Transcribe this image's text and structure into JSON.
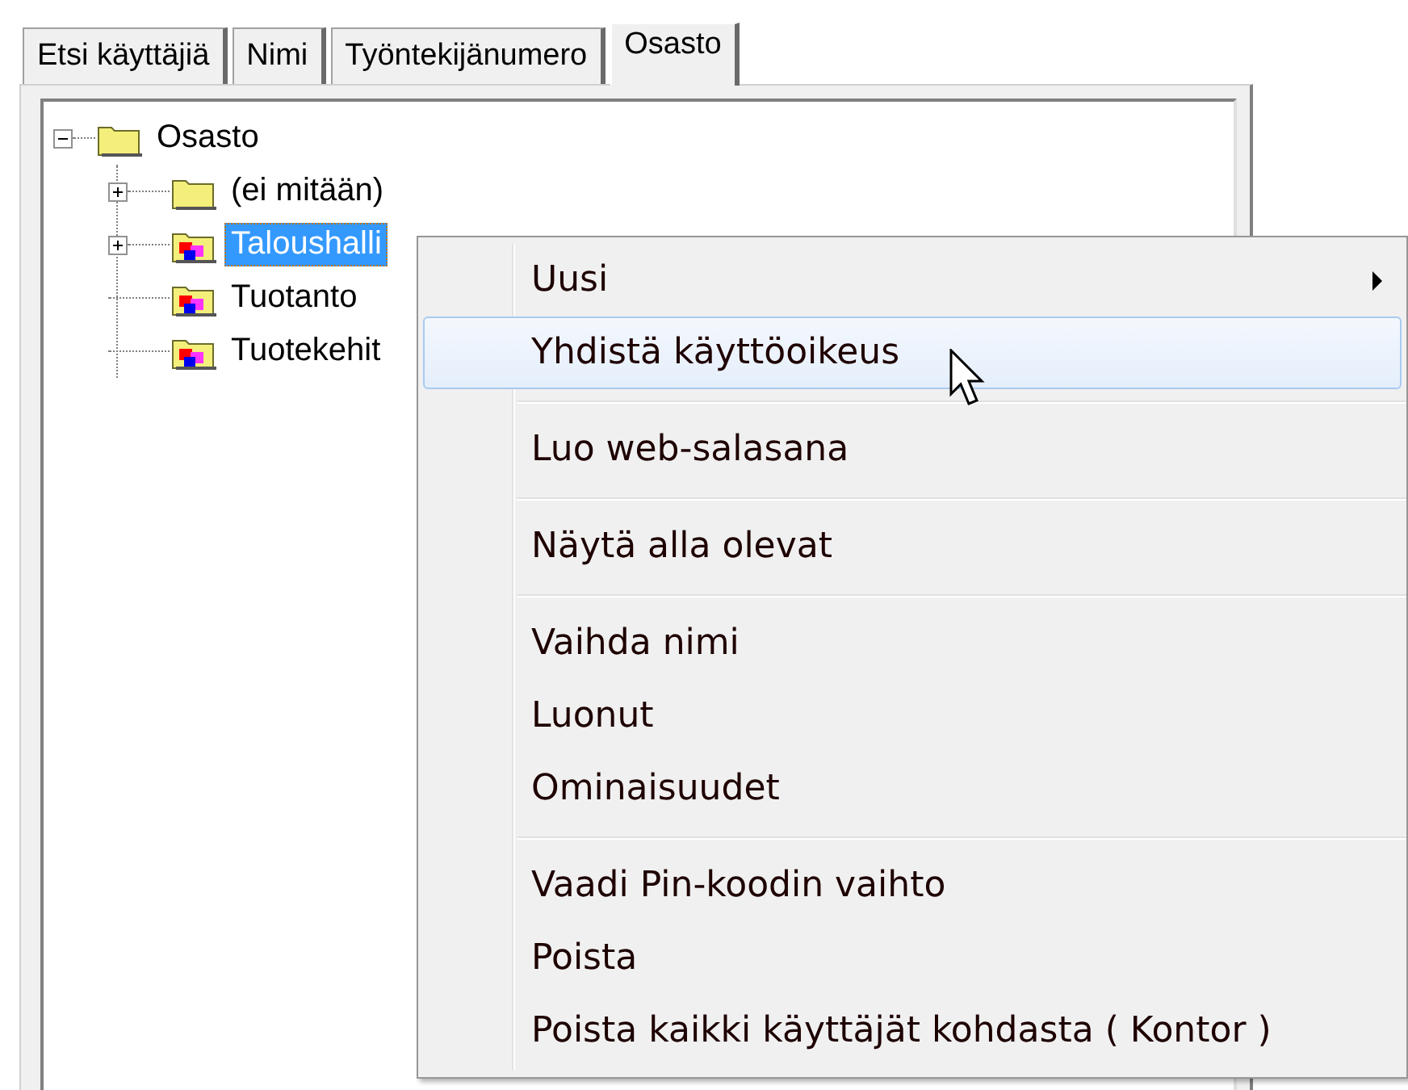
{
  "tabs": [
    {
      "label": "Etsi käyttäjiä",
      "selected": false
    },
    {
      "label": "Nimi",
      "selected": false
    },
    {
      "label": "Työntekijänumero",
      "selected": false
    },
    {
      "label": "Osasto",
      "selected": true
    }
  ],
  "tree": [
    {
      "label": "Osasto",
      "kind": "plain",
      "expanded": true,
      "selected": false,
      "children": [
        {
          "label": "(ei mitään)",
          "kind": "plain",
          "expanded": false,
          "selected": false
        },
        {
          "label": "Taloushalli",
          "kind": "department",
          "expanded": false,
          "selected": true
        },
        {
          "label": "Tuotanto",
          "kind": "department",
          "selected": false
        },
        {
          "label": "Tuotekehit",
          "kind": "department",
          "selected": false
        }
      ]
    }
  ],
  "context_menu": [
    {
      "kind": "item",
      "label": "Uusi",
      "submenu": true,
      "selected": false
    },
    {
      "kind": "item",
      "label": "Yhdistä käyttöoikeus",
      "submenu": false,
      "selected": true
    },
    {
      "kind": "separator"
    },
    {
      "kind": "item",
      "label": "Luo web-salasana",
      "submenu": false,
      "selected": false
    },
    {
      "kind": "separator"
    },
    {
      "kind": "item",
      "label": "Näytä alla olevat",
      "submenu": false,
      "selected": false
    },
    {
      "kind": "separator"
    },
    {
      "kind": "item",
      "label": "Vaihda nimi",
      "submenu": false,
      "selected": false
    },
    {
      "kind": "item",
      "label": "Luonut",
      "submenu": false,
      "selected": false
    },
    {
      "kind": "item",
      "label": "Ominaisuudet",
      "submenu": false,
      "selected": false
    },
    {
      "kind": "separator"
    },
    {
      "kind": "item",
      "label": "Vaadi Pin-koodin vaihto",
      "submenu": false,
      "selected": false
    },
    {
      "kind": "item",
      "label": "Poista",
      "submenu": false,
      "selected": false
    },
    {
      "kind": "item",
      "label": "Poista kaikki käyttäjät kohdasta ( Kontor )",
      "submenu": false,
      "selected": false
    }
  ]
}
